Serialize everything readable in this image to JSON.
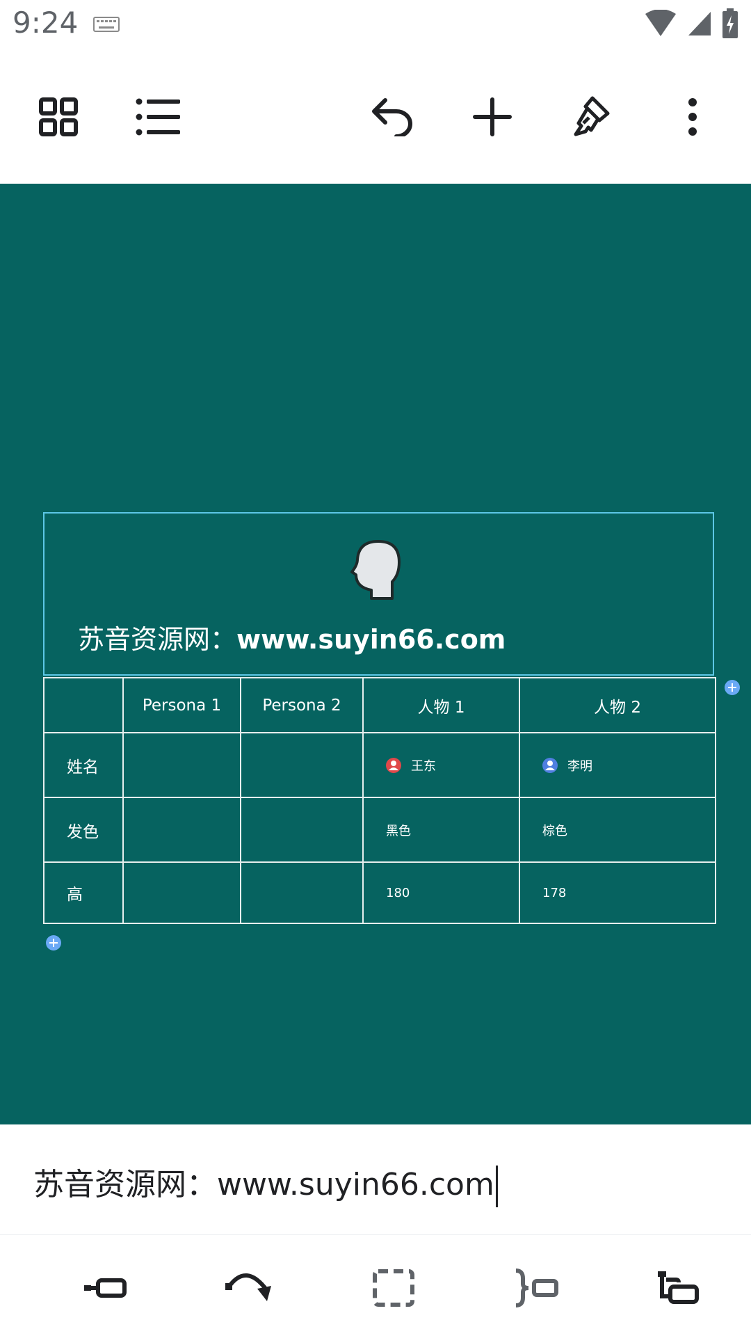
{
  "status": {
    "time": "9:24"
  },
  "icons": {
    "toolbar": [
      "grid-view-icon",
      "list-icon",
      "undo-icon",
      "add-icon",
      "format-paint-icon",
      "more-vert-icon"
    ],
    "bottom": [
      "node-left-icon",
      "redo-arc-icon",
      "boundary-icon",
      "summary-icon",
      "sub-node-icon"
    ]
  },
  "colors": {
    "canvas": "#066360",
    "selection": "#5cc7e6",
    "add_dot": "#6aa9f5",
    "avatar_red": "#e0484a",
    "avatar_blue": "#4f7fe0"
  },
  "node": {
    "title_cn": "苏音资源网：",
    "title_url": "www.suyin66.com"
  },
  "table": {
    "headers": [
      "",
      "Persona 1",
      "Persona 2",
      "人物 1",
      "人物 2"
    ],
    "rows": [
      {
        "label": "姓名",
        "c1": "",
        "c2": "",
        "c3": "王东",
        "c4": "李明"
      },
      {
        "label": "发色",
        "c1": "",
        "c2": "",
        "c3": "黑色",
        "c4": "棕色"
      },
      {
        "label": "高",
        "c1": "",
        "c2": "",
        "c3": "180",
        "c4": "178"
      }
    ]
  },
  "editor": {
    "text": "苏音资源网：www.suyin66.com"
  }
}
